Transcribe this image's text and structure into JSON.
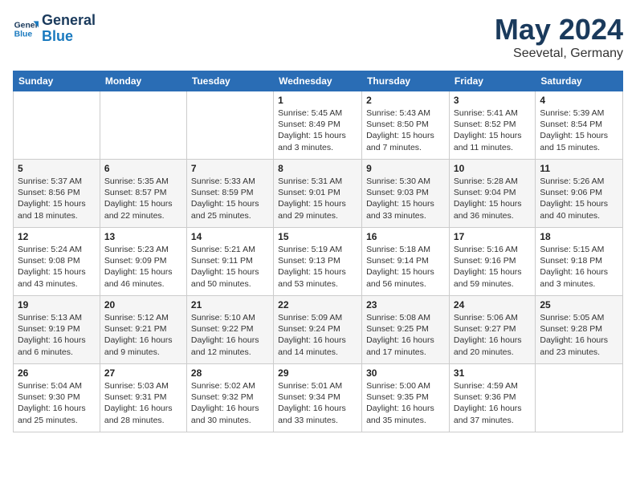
{
  "logo": {
    "line1": "General",
    "line2": "Blue"
  },
  "title": "May 2024",
  "subtitle": "Seevetal, Germany",
  "days_of_week": [
    "Sunday",
    "Monday",
    "Tuesday",
    "Wednesday",
    "Thursday",
    "Friday",
    "Saturday"
  ],
  "weeks": [
    [
      {
        "day": "",
        "info": ""
      },
      {
        "day": "",
        "info": ""
      },
      {
        "day": "",
        "info": ""
      },
      {
        "day": "1",
        "info": "Sunrise: 5:45 AM\nSunset: 8:49 PM\nDaylight: 15 hours\nand 3 minutes."
      },
      {
        "day": "2",
        "info": "Sunrise: 5:43 AM\nSunset: 8:50 PM\nDaylight: 15 hours\nand 7 minutes."
      },
      {
        "day": "3",
        "info": "Sunrise: 5:41 AM\nSunset: 8:52 PM\nDaylight: 15 hours\nand 11 minutes."
      },
      {
        "day": "4",
        "info": "Sunrise: 5:39 AM\nSunset: 8:54 PM\nDaylight: 15 hours\nand 15 minutes."
      }
    ],
    [
      {
        "day": "5",
        "info": "Sunrise: 5:37 AM\nSunset: 8:56 PM\nDaylight: 15 hours\nand 18 minutes."
      },
      {
        "day": "6",
        "info": "Sunrise: 5:35 AM\nSunset: 8:57 PM\nDaylight: 15 hours\nand 22 minutes."
      },
      {
        "day": "7",
        "info": "Sunrise: 5:33 AM\nSunset: 8:59 PM\nDaylight: 15 hours\nand 25 minutes."
      },
      {
        "day": "8",
        "info": "Sunrise: 5:31 AM\nSunset: 9:01 PM\nDaylight: 15 hours\nand 29 minutes."
      },
      {
        "day": "9",
        "info": "Sunrise: 5:30 AM\nSunset: 9:03 PM\nDaylight: 15 hours\nand 33 minutes."
      },
      {
        "day": "10",
        "info": "Sunrise: 5:28 AM\nSunset: 9:04 PM\nDaylight: 15 hours\nand 36 minutes."
      },
      {
        "day": "11",
        "info": "Sunrise: 5:26 AM\nSunset: 9:06 PM\nDaylight: 15 hours\nand 40 minutes."
      }
    ],
    [
      {
        "day": "12",
        "info": "Sunrise: 5:24 AM\nSunset: 9:08 PM\nDaylight: 15 hours\nand 43 minutes."
      },
      {
        "day": "13",
        "info": "Sunrise: 5:23 AM\nSunset: 9:09 PM\nDaylight: 15 hours\nand 46 minutes."
      },
      {
        "day": "14",
        "info": "Sunrise: 5:21 AM\nSunset: 9:11 PM\nDaylight: 15 hours\nand 50 minutes."
      },
      {
        "day": "15",
        "info": "Sunrise: 5:19 AM\nSunset: 9:13 PM\nDaylight: 15 hours\nand 53 minutes."
      },
      {
        "day": "16",
        "info": "Sunrise: 5:18 AM\nSunset: 9:14 PM\nDaylight: 15 hours\nand 56 minutes."
      },
      {
        "day": "17",
        "info": "Sunrise: 5:16 AM\nSunset: 9:16 PM\nDaylight: 15 hours\nand 59 minutes."
      },
      {
        "day": "18",
        "info": "Sunrise: 5:15 AM\nSunset: 9:18 PM\nDaylight: 16 hours\nand 3 minutes."
      }
    ],
    [
      {
        "day": "19",
        "info": "Sunrise: 5:13 AM\nSunset: 9:19 PM\nDaylight: 16 hours\nand 6 minutes."
      },
      {
        "day": "20",
        "info": "Sunrise: 5:12 AM\nSunset: 9:21 PM\nDaylight: 16 hours\nand 9 minutes."
      },
      {
        "day": "21",
        "info": "Sunrise: 5:10 AM\nSunset: 9:22 PM\nDaylight: 16 hours\nand 12 minutes."
      },
      {
        "day": "22",
        "info": "Sunrise: 5:09 AM\nSunset: 9:24 PM\nDaylight: 16 hours\nand 14 minutes."
      },
      {
        "day": "23",
        "info": "Sunrise: 5:08 AM\nSunset: 9:25 PM\nDaylight: 16 hours\nand 17 minutes."
      },
      {
        "day": "24",
        "info": "Sunrise: 5:06 AM\nSunset: 9:27 PM\nDaylight: 16 hours\nand 20 minutes."
      },
      {
        "day": "25",
        "info": "Sunrise: 5:05 AM\nSunset: 9:28 PM\nDaylight: 16 hours\nand 23 minutes."
      }
    ],
    [
      {
        "day": "26",
        "info": "Sunrise: 5:04 AM\nSunset: 9:30 PM\nDaylight: 16 hours\nand 25 minutes."
      },
      {
        "day": "27",
        "info": "Sunrise: 5:03 AM\nSunset: 9:31 PM\nDaylight: 16 hours\nand 28 minutes."
      },
      {
        "day": "28",
        "info": "Sunrise: 5:02 AM\nSunset: 9:32 PM\nDaylight: 16 hours\nand 30 minutes."
      },
      {
        "day": "29",
        "info": "Sunrise: 5:01 AM\nSunset: 9:34 PM\nDaylight: 16 hours\nand 33 minutes."
      },
      {
        "day": "30",
        "info": "Sunrise: 5:00 AM\nSunset: 9:35 PM\nDaylight: 16 hours\nand 35 minutes."
      },
      {
        "day": "31",
        "info": "Sunrise: 4:59 AM\nSunset: 9:36 PM\nDaylight: 16 hours\nand 37 minutes."
      },
      {
        "day": "",
        "info": ""
      }
    ]
  ]
}
